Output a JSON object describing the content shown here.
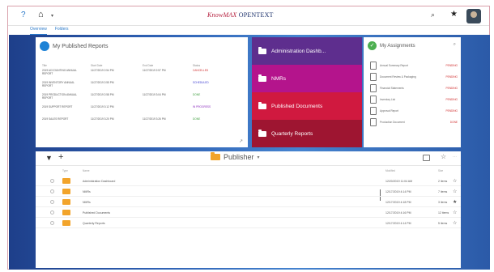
{
  "topbar": {
    "help_icon": "?",
    "home_icon": "home-icon",
    "brand_km": "KnowMAX",
    "brand_ot": " OPENTEXT",
    "search_icon": "search-icon",
    "star_icon": "★"
  },
  "subtabs": [
    "Overview",
    "Folders"
  ],
  "published_reports": {
    "title": "My Published Reports",
    "columns": [
      "Title",
      "Start Date",
      "End Date",
      "Status"
    ],
    "rows": [
      {
        "title": "2019 ACCOUNTING ANNUAL REPORT",
        "start": "11/27/2019 2:54 PM",
        "end": "11/27/2019 2:57 PM",
        "status": "CANCELLED",
        "status_class": "st-red"
      },
      {
        "title": "2019 INVENTORY ANNUAL REPORT",
        "start": "11/27/2019 2:55 PM",
        "end": "",
        "status": "SCHEDULED",
        "status_class": "st-blue"
      },
      {
        "title": "2019 PRODUCTION ANNUAL REPORT",
        "start": "11/27/2019 2:58 PM",
        "end": "11/27/2019 3:04 PM",
        "status": "DONE",
        "status_class": "st-green"
      },
      {
        "title": "2019 SUPPORT REPORT",
        "start": "11/27/2019 3:12 PM",
        "end": "",
        "status": "IN PROGRESS",
        "status_class": "st-purple"
      },
      {
        "title": "2019 SALES REPORT",
        "start": "11/27/2019 3:20 PM",
        "end": "11/27/2019 3:26 PM",
        "status": "DONE",
        "status_class": "st-green"
      }
    ]
  },
  "tiles": [
    "Administration Dashb...",
    "NMRs",
    "Published Documents",
    "Quarterly Reports"
  ],
  "assignments": {
    "title": "My Assignments",
    "rows": [
      {
        "text": "Annual Summary Report",
        "tag": "PENDING"
      },
      {
        "text": "Document Review & Packaging",
        "tag": "PENDING"
      },
      {
        "text": "Financial Statements",
        "tag": "PENDING"
      },
      {
        "text": "Inventory List",
        "tag": "PENDING"
      },
      {
        "text": "Approval Report",
        "tag": "PENDING"
      },
      {
        "text": "Production Document",
        "tag": "DONE"
      }
    ]
  },
  "files": {
    "breadcrumb": "Publisher",
    "columns": [
      "Type",
      "Name",
      "Modified",
      "Size"
    ],
    "rows": [
      {
        "name": "Administration Dashboard",
        "date": "12/20/2019 11:04 AM",
        "size": "2 items"
      },
      {
        "name": "NMRs",
        "date": "12/17/2019 4:14 PM",
        "size": "7 items"
      },
      {
        "name": "NMRs",
        "date": "12/17/2019 4:18 PM",
        "size": "3 items"
      },
      {
        "name": "Published Documents",
        "date": "12/17/2019 4:16 PM",
        "size": "12 items"
      },
      {
        "name": "Quarterly Reports",
        "date": "12/17/2019 4:14 PM",
        "size": "5 items"
      }
    ]
  }
}
